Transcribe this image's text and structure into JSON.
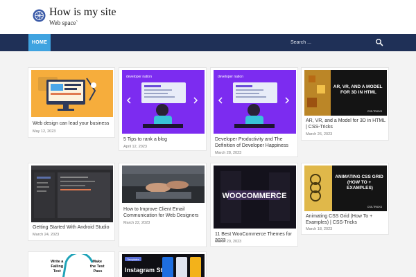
{
  "site": {
    "title": "How is my site",
    "tagline": "Web space`"
  },
  "nav": {
    "home_label": "HOME",
    "search_placeholder": "Search ..."
  },
  "icons": {
    "logo": "globe-logo-icon",
    "search": "search-icon"
  },
  "colors": {
    "navbar": "#1f3057",
    "nav_active": "#3fa3e0"
  },
  "posts": [
    {
      "title": "Web design can lead your business",
      "date": "May 12, 2023"
    },
    {
      "title": "5 Tips to rank a blog",
      "date": "April 12, 2023",
      "image_badge": "developer nation"
    },
    {
      "title": "Developer Productivity and The Definition of Developer Happiness",
      "date": "March 28, 2023",
      "image_badge": "developer nation"
    },
    {
      "title": "AR, VR, and a Model for 3D in HTML | CSS-Tricks",
      "date": "March 26, 2023",
      "image_text": "AR, VR, AND A MODEL FOR 3D IN HTML",
      "image_tag": "CSS-TRICKS"
    },
    {
      "title": "Getting Started With Android Studio",
      "date": "March 24, 2023"
    },
    {
      "title": "How to Improve Client Email Communication for Web Designers",
      "date": "March 22, 2023"
    },
    {
      "title": "11 Best WooCommerce Themes for 2023",
      "date": "March 20, 2023",
      "image_text": "WOOCOMMERCE"
    },
    {
      "title": "Animating CSS Grid (How To + Examples) | CSS-Tricks",
      "date": "March 18, 2023",
      "image_text": "ANIMATING CSS GRID (HOW TO + EXAMPLES)",
      "image_tag": "CSS-TRICKS"
    },
    {
      "image_text_lines": [
        "Write a",
        "Failing",
        "Test",
        "Make",
        "the Test",
        "Pass"
      ]
    },
    {
      "image_text": "Instagram Stra",
      "image_badge": "Templates"
    }
  ]
}
